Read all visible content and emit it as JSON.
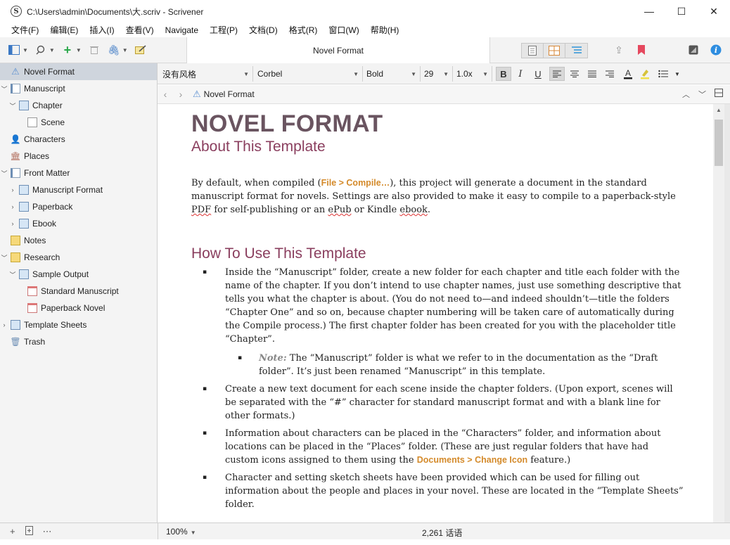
{
  "window": {
    "title": "C:\\Users\\admin\\Documents\\大.scriv - Scrivener",
    "app_icon_glyph": "S",
    "minimize": "—",
    "maximize": "☐",
    "close": "✕"
  },
  "menubar": [
    "文件(F)",
    "编辑(E)",
    "插入(I)",
    "查看(V)",
    "Navigate",
    "工程(P)",
    "文档(D)",
    "格式(R)",
    "窗口(W)",
    "帮助(H)"
  ],
  "toolbar": {
    "document_title": "Novel Format"
  },
  "binder": {
    "items": [
      {
        "label": "Novel Format",
        "icon": "warning-icon"
      },
      {
        "label": "Manuscript",
        "icon": "manuscript-icon"
      },
      {
        "label": "Chapter",
        "icon": "folder-icon"
      },
      {
        "label": "Scene",
        "icon": "page-icon"
      },
      {
        "label": "Characters",
        "icon": "characters-icon"
      },
      {
        "label": "Places",
        "icon": "places-icon"
      },
      {
        "label": "Front Matter",
        "icon": "front-matter-icon"
      },
      {
        "label": "Manuscript Format",
        "icon": "folder-icon"
      },
      {
        "label": "Paperback",
        "icon": "folder-icon"
      },
      {
        "label": "Ebook",
        "icon": "folder-icon"
      },
      {
        "label": "Notes",
        "icon": "notes-icon"
      },
      {
        "label": "Research",
        "icon": "research-icon"
      },
      {
        "label": "Sample Output",
        "icon": "folder-icon"
      },
      {
        "label": "Standard Manuscript",
        "icon": "pdf-icon"
      },
      {
        "label": "Paperback Novel",
        "icon": "pdf-icon"
      },
      {
        "label": "Template Sheets",
        "icon": "template-icon"
      },
      {
        "label": "Trash",
        "icon": "trash-icon"
      }
    ]
  },
  "formatbar": {
    "style": "没有风格",
    "font": "Corbel",
    "weight": "Bold",
    "size": "29",
    "line_spacing": "1.0x"
  },
  "editor_header": {
    "crumb": "Novel Format"
  },
  "doc": {
    "h1": "NOVEL FORMAT",
    "h2_about": "About This Template",
    "p1_a": "By default, when compiled (",
    "p1_link": "File > Compile…",
    "p1_b": "), this project will generate a document in the standard manuscript format for novels. Settings are also provided to make it easy to compile to a paperback-style ",
    "p1_pdf": "PDF",
    "p1_c": " for self-publishing or an ",
    "p1_epub": "ePub",
    "p1_d": " or Kindle ",
    "p1_ebook": "ebook",
    "p1_e": ".",
    "h2_how": "How To Use This Template",
    "b1": "Inside the “Manuscript” folder, create a new folder for each chapter and title each folder with the name of the chapter. If you don’t intend to use chapter names, just use something descriptive that tells you what the chapter is about. (You do not need to—and indeed shouldn’t—title the folders “Chapter One” and so on, because chapter numbering will be taken care of automatically during the Compile process.) The first chapter folder has been created for you with the placeholder title “Chapter”.",
    "b1_note_label": "Note:",
    "b1_note": " The “Manuscript” folder is what we refer to in the documentation as the “Draft folder”. It’s just been renamed “Manuscript” in this template.",
    "b2": "Create a new text document for each scene inside the chapter folders. (Upon export, scenes will be separated with the “#” character for standard manuscript format and with a blank line for other formats.)",
    "b3_a": "Information about characters can be placed in the “Characters” folder, and information about locations can be placed in the “Places” folder. (These are just regular folders that have had custom icons assigned to them using the ",
    "b3_link": "Documents > Change Icon",
    "b3_b": " feature.)",
    "b4": "Character and setting sketch sheets have been provided which can be used for filling out information about the people and places in your novel. These are located in the “Template Sheets” folder."
  },
  "footer": {
    "zoom": "100%",
    "wordcount": "2,261 话语"
  }
}
